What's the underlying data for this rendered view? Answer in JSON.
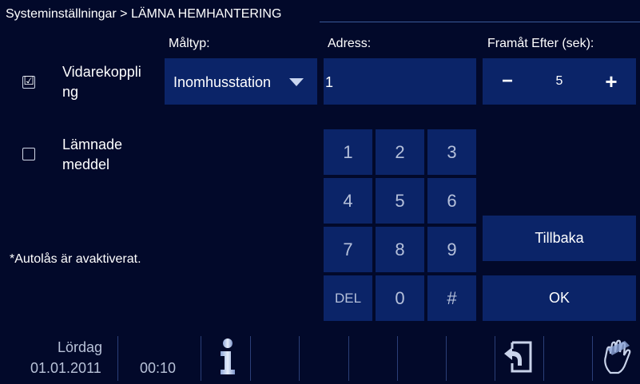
{
  "header": {
    "title": "Systeminställningar > LÄMNA HEMHANTERING"
  },
  "columns": {
    "target_type_label": "Måltyp:",
    "address_label": "Adress:",
    "forward_after_label": "Framåt Efter (sek):"
  },
  "options": [
    {
      "label_line1": "Vidarekoppli",
      "label_line2": "ng",
      "checked": true,
      "check_glyph": "☑"
    },
    {
      "label_line1": "Lämnade",
      "label_line2": "meddel",
      "checked": false,
      "check_glyph": ""
    }
  ],
  "target_type": {
    "value": "Inomhusstation"
  },
  "address": {
    "value": "1"
  },
  "forward_after": {
    "minus": "−",
    "value": "5",
    "plus": "+"
  },
  "keypad": {
    "keys": [
      "1",
      "2",
      "3",
      "4",
      "5",
      "6",
      "7",
      "8",
      "9",
      "DEL",
      "0",
      "#"
    ]
  },
  "note": "*Autolås är avaktiverat.",
  "buttons": {
    "back": "Tillbaka",
    "ok": "OK"
  },
  "status": {
    "day": "Lördag",
    "date": "01.01.2011",
    "time": "00:10",
    "info_glyph": "i"
  },
  "colors": {
    "background": "#02092a",
    "panel": "#0b2468",
    "separator": "#2b3f78"
  }
}
